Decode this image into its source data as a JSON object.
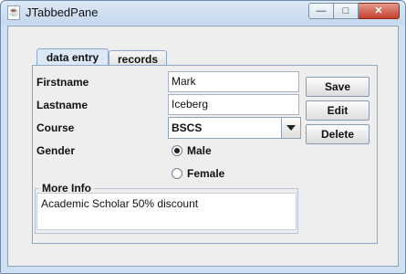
{
  "window": {
    "title": "JTabbedPane",
    "icon": "java-icon",
    "min": "—",
    "max": "□",
    "close": "✕"
  },
  "tabs": [
    {
      "label": "data entry",
      "active": true
    },
    {
      "label": "records",
      "active": false
    }
  ],
  "form": {
    "firstname_label": "Firstname",
    "firstname_value": "Mark",
    "lastname_label": "Lastname",
    "lastname_value": "Iceberg",
    "course_label": "Course",
    "course_value": "BSCS",
    "gender_label": "Gender",
    "gender_options": [
      {
        "label": "Male",
        "selected": true
      },
      {
        "label": "Female",
        "selected": false
      }
    ]
  },
  "buttons": {
    "save": "Save",
    "edit": "Edit",
    "delete": "Delete"
  },
  "more_info": {
    "title": "More Info",
    "text": "Academic Scholar 50% discount"
  }
}
